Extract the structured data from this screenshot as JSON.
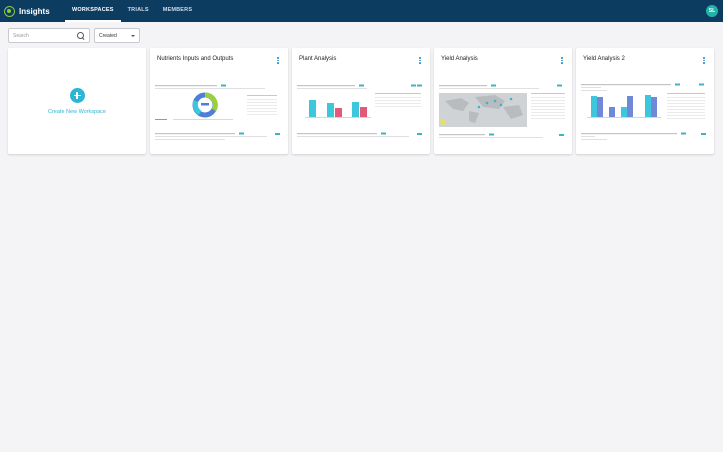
{
  "app": {
    "title": "Insights"
  },
  "nav": {
    "tabs": [
      {
        "label": "WORKSPACES",
        "active": true
      },
      {
        "label": "TRIALS",
        "active": false
      },
      {
        "label": "MEMBERS",
        "active": false
      }
    ]
  },
  "user": {
    "initials": "SL"
  },
  "toolbar": {
    "search_placeholder": "Search",
    "sort_selected": "Created"
  },
  "create_card": {
    "label": "Create New Workspace"
  },
  "workspaces": [
    {
      "title": "Nutrients Inputs and Outputs"
    },
    {
      "title": "Plant Analysis"
    },
    {
      "title": "Yield Analysis"
    },
    {
      "title": "Yield Analysis 2"
    }
  ],
  "colors": {
    "header": "#0d3c61",
    "accent": "#2eb5d6",
    "bar_cyan": "#3ec6dd",
    "bar_pink": "#e15a7a",
    "bar_blue": "#6f88d8",
    "donut_green": "#9ad13a",
    "donut_blue": "#4f7fd6"
  },
  "icons": [
    "logo-icon",
    "search-icon",
    "chevron-down-icon",
    "plus-icon",
    "more-vert-icon"
  ]
}
